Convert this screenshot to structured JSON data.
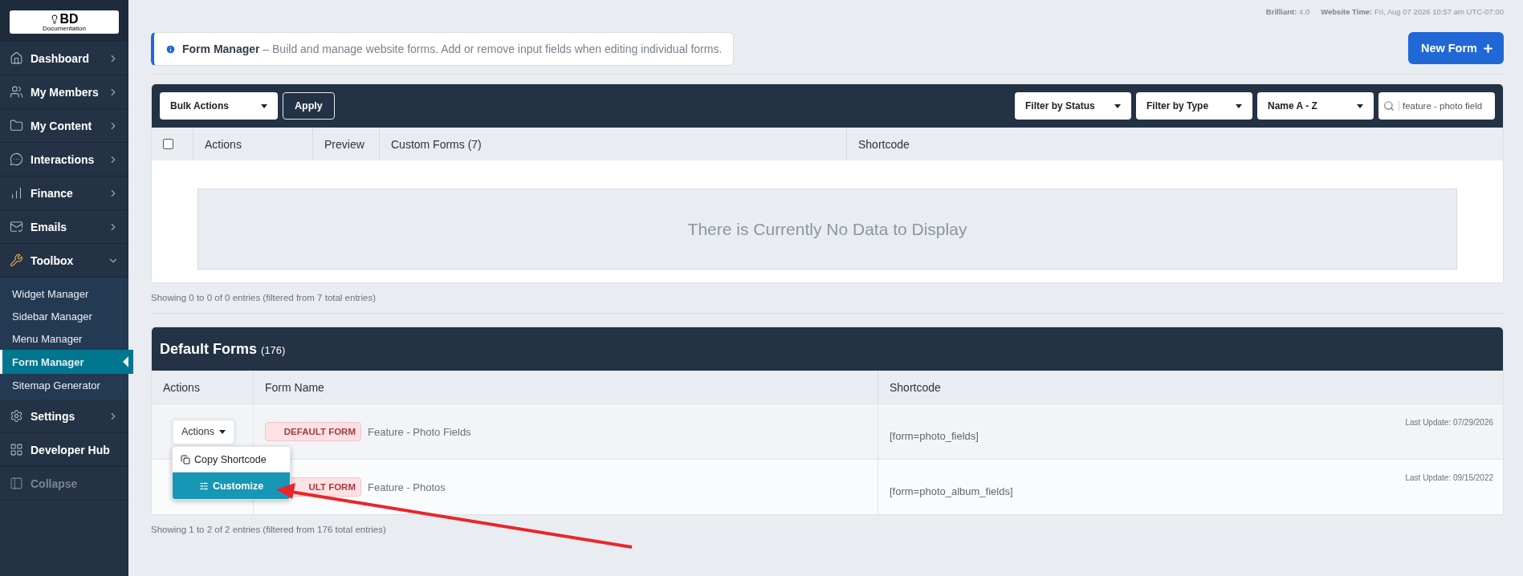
{
  "sidebar": {
    "logo": {
      "text": "BD",
      "subtext": "Documentation"
    },
    "items": [
      {
        "label": "Dashboard",
        "kind": "group",
        "expanded": false
      },
      {
        "label": "My Members",
        "kind": "group",
        "expanded": false
      },
      {
        "label": "My Content",
        "kind": "group",
        "expanded": false
      },
      {
        "label": "Interactions",
        "kind": "group",
        "expanded": false
      },
      {
        "label": "Finance",
        "kind": "group",
        "expanded": false
      },
      {
        "label": "Emails",
        "kind": "group",
        "expanded": false
      },
      {
        "label": "Toolbox",
        "kind": "group",
        "expanded": true,
        "children": [
          {
            "label": "Widget Manager",
            "selected": false
          },
          {
            "label": "Sidebar Manager",
            "selected": false
          },
          {
            "label": "Menu Manager",
            "selected": false
          },
          {
            "label": "Form Manager",
            "selected": true
          },
          {
            "label": "Sitemap Generator",
            "selected": false
          }
        ]
      },
      {
        "label": "Settings",
        "kind": "group",
        "expanded": false
      },
      {
        "label": "Developer Hub",
        "kind": "link"
      },
      {
        "label": "Collapse",
        "kind": "toggle"
      }
    ]
  },
  "meta": [
    {
      "label": "Brilliant:",
      "value": "4.0"
    },
    {
      "label": "Website Time:",
      "value": "Fri, Aug 07 2026 10:57 am UTC-07:00"
    }
  ],
  "notice": {
    "title": "Form Manager",
    "text": "– Build and manage website forms. Add or remove input fields when editing individual forms."
  },
  "new_form_button": "New Form",
  "custom_forms": {
    "bulk_select": "Bulk Actions",
    "apply": "Apply",
    "filters": [
      "Filter by Status",
      "Filter by Type",
      "Name A - Z"
    ],
    "search": {
      "value": "feature - photo field"
    },
    "select_all": {
      "checked": false
    },
    "columns": [
      "Actions",
      "Preview",
      "Custom Forms (7)",
      "Shortcode"
    ],
    "empty_message": "There is Currently No Data to Display",
    "footer": "Showing 0 to 0 of 0 entries (filtered from 7 total entries)"
  },
  "default_forms": {
    "title": "Default Forms",
    "count": "(176)",
    "columns": [
      "Actions",
      "Form Name",
      "Shortcode"
    ],
    "rows": [
      {
        "actions": "Actions",
        "badge": "DEFAULT FORM",
        "name": "Feature - Photo Fields",
        "shortcode": "[form=photo_fields]",
        "updated": "Last Update: 07/29/2026"
      },
      {
        "badge": "ULT FORM",
        "name": "Feature - Photos",
        "shortcode": "[form=photo_album_fields]",
        "updated": "Last Update: 09/15/2022"
      }
    ],
    "footer": "Showing 1 to 2 of 2 entries (filtered from 176 total entries)"
  },
  "action_menu": {
    "items": [
      {
        "label": "Copy Shortcode",
        "selected": false
      },
      {
        "label": "Customize",
        "selected": true
      }
    ]
  }
}
